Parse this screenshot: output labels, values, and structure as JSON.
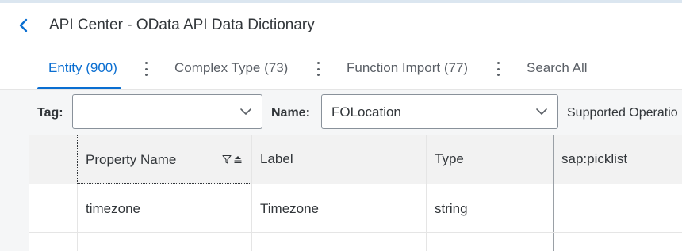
{
  "header": {
    "title": "API Center - OData API Data Dictionary"
  },
  "tabs": [
    {
      "label": "Entity (900)",
      "active": true
    },
    {
      "label": "Complex Type (73)",
      "active": false
    },
    {
      "label": "Function Import (77)",
      "active": false
    },
    {
      "label": "Search All",
      "active": false
    }
  ],
  "filters": {
    "tag_label": "Tag:",
    "tag_value": "",
    "name_label": "Name:",
    "name_value": "FOLocation",
    "supported_label": "Supported Operatio"
  },
  "table": {
    "columns": [
      "Property Name",
      "Label",
      "Type",
      "sap:picklist"
    ],
    "rows": [
      [
        "timezone",
        "Timezone",
        "string",
        ""
      ]
    ]
  },
  "colors": {
    "accent": "#0a6ed1",
    "text": "#32363a",
    "background": "#f5f6f7"
  }
}
